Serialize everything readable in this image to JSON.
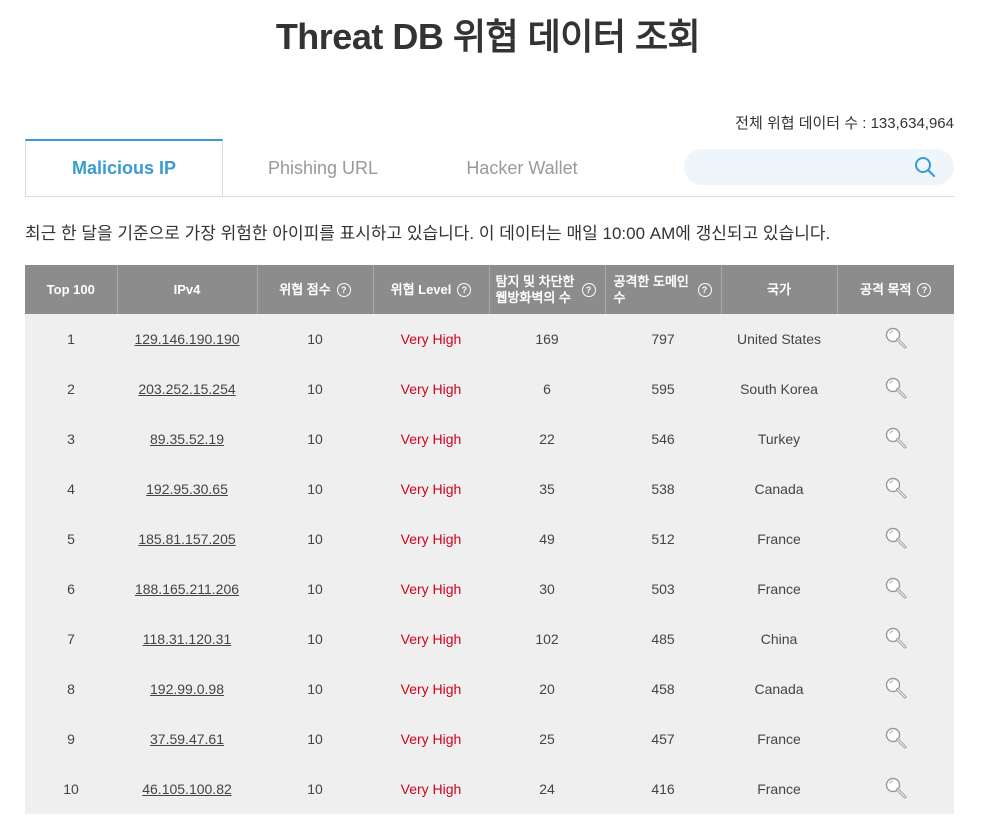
{
  "title": "Threat DB 위협 데이터 조회",
  "total_label": "전체 위협 데이터 수 : 133,634,964",
  "tabs": [
    {
      "label": "Malicious IP",
      "active": true
    },
    {
      "label": "Phishing URL",
      "active": false
    },
    {
      "label": "Hacker Wallet",
      "active": false
    }
  ],
  "search": {
    "placeholder": "",
    "value": ""
  },
  "description": "최근 한 달을 기준으로 가장 위험한 아이피를 표시하고 있습니다. 이 데이터는 매일 10:00 AM에 갱신되고 있습니다.",
  "table": {
    "headers": {
      "rank": "Top 100",
      "ipv4": "IPv4",
      "score": "위협 점수",
      "level": "위협 Level",
      "waf": "탐지 및 차단한 웹방화벽의 수",
      "domains": "공격한 도메인 수",
      "country": "국가",
      "purpose": "공격 목적"
    },
    "rows": [
      {
        "rank": "1",
        "ip": "129.146.190.190",
        "score": "10",
        "level": "Very High",
        "waf": "169",
        "domains": "797",
        "country": "United States"
      },
      {
        "rank": "2",
        "ip": "203.252.15.254",
        "score": "10",
        "level": "Very High",
        "waf": "6",
        "domains": "595",
        "country": "South Korea"
      },
      {
        "rank": "3",
        "ip": "89.35.52.19",
        "score": "10",
        "level": "Very High",
        "waf": "22",
        "domains": "546",
        "country": "Turkey"
      },
      {
        "rank": "4",
        "ip": "192.95.30.65",
        "score": "10",
        "level": "Very High",
        "waf": "35",
        "domains": "538",
        "country": "Canada"
      },
      {
        "rank": "5",
        "ip": "185.81.157.205",
        "score": "10",
        "level": "Very High",
        "waf": "49",
        "domains": "512",
        "country": "France"
      },
      {
        "rank": "6",
        "ip": "188.165.211.206",
        "score": "10",
        "level": "Very High",
        "waf": "30",
        "domains": "503",
        "country": "France"
      },
      {
        "rank": "7",
        "ip": "118.31.120.31",
        "score": "10",
        "level": "Very High",
        "waf": "102",
        "domains": "485",
        "country": "China"
      },
      {
        "rank": "8",
        "ip": "192.99.0.98",
        "score": "10",
        "level": "Very High",
        "waf": "20",
        "domains": "458",
        "country": "Canada"
      },
      {
        "rank": "9",
        "ip": "37.59.47.61",
        "score": "10",
        "level": "Very High",
        "waf": "25",
        "domains": "457",
        "country": "France"
      },
      {
        "rank": "10",
        "ip": "46.105.100.82",
        "score": "10",
        "level": "Very High",
        "waf": "24",
        "domains": "416",
        "country": "France"
      }
    ]
  },
  "icons": {
    "search": "search-icon",
    "purpose": "magnifier-icon",
    "help": "question-circle-icon"
  },
  "colors": {
    "accent": "#3a9bd1",
    "header_bg": "#8c8c8c",
    "row_bg": "#efefef",
    "danger": "#d0021b",
    "search_bg": "#eef6fb"
  }
}
